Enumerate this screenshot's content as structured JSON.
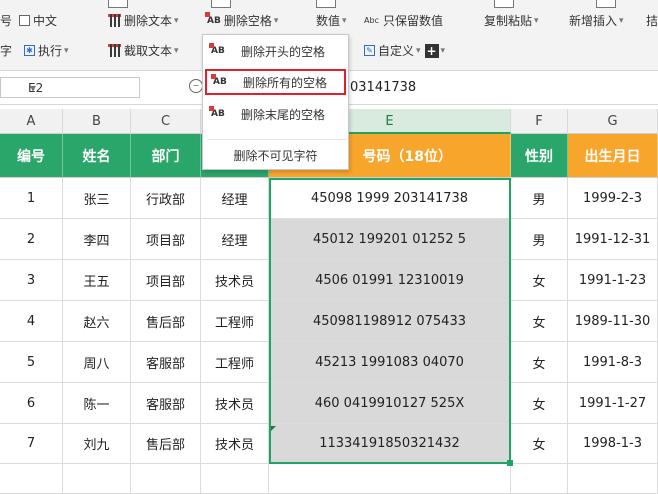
{
  "ribbon": {
    "row1": {
      "label_left": "号",
      "chinese_checkbox_label": "中文",
      "delete_text_label": "删除文本",
      "delete_spaces_label": "删除空格",
      "value_label": "数值",
      "keep_values_label": "只保留数值",
      "copy_paste_label": "复制粘贴",
      "add_insert_label": "新增插入",
      "tail_label": "拮"
    },
    "row2": {
      "label_left": "字",
      "execute_label": "执行",
      "truncate_text_label": "截取文本",
      "custom_label": "自定义",
      "plus_label": "+"
    },
    "abc_icon_text": "Abc"
  },
  "formula_bar": {
    "cell_reference": "E2",
    "value": "03141738"
  },
  "columns": [
    "A",
    "B",
    "C",
    "D",
    "E",
    "F",
    "G"
  ],
  "header_row": [
    "编号",
    "姓名",
    "部门",
    "",
    "号码（18位）",
    "性别",
    "出生月日"
  ],
  "rows": [
    {
      "id": "1",
      "name": "张三",
      "dept": "行政部",
      "title": "经理",
      "number": "45098 1999 203141738",
      "gender": "男",
      "birth": "1999-2-3"
    },
    {
      "id": "2",
      "name": "李四",
      "dept": "项目部",
      "title": "经理",
      "number": "45012 199201 01252 5",
      "gender": "男",
      "birth": "1991-12-31"
    },
    {
      "id": "3",
      "name": "王五",
      "dept": "项目部",
      "title": "技术员",
      "number": "4506 01991 12310019",
      "gender": "女",
      "birth": "1991-1-23"
    },
    {
      "id": "4",
      "name": "赵六",
      "dept": "售后部",
      "title": "工程师",
      "number": "450981198912 075433",
      "gender": "女",
      "birth": "1989-11-30"
    },
    {
      "id": "5",
      "name": "周八",
      "dept": "客服部",
      "title": "工程师",
      "number": "45213 1991083 04070",
      "gender": "女",
      "birth": "1991-8-3"
    },
    {
      "id": "6",
      "name": "陈一",
      "dept": "客服部",
      "title": "技术员",
      "number": "460 0419910127 525X",
      "gender": "女",
      "birth": "1991-1-27"
    },
    {
      "id": "7",
      "name": "刘九",
      "dept": "售后部",
      "title": "技术员",
      "number": "11334191850321432",
      "gender": "女",
      "birth": "1998-1-3"
    }
  ],
  "dropdown_menu": {
    "items": [
      "删除开头的空格",
      "删除所有的空格",
      "删除末尾的空格",
      "删除不可见字符"
    ],
    "highlighted_index": 1,
    "icon_text": "AB"
  },
  "colors": {
    "header_green": "#2aa66a",
    "header_orange": "#f7a52b",
    "selection_green": "#21a366",
    "highlight_red": "#e0202a"
  }
}
